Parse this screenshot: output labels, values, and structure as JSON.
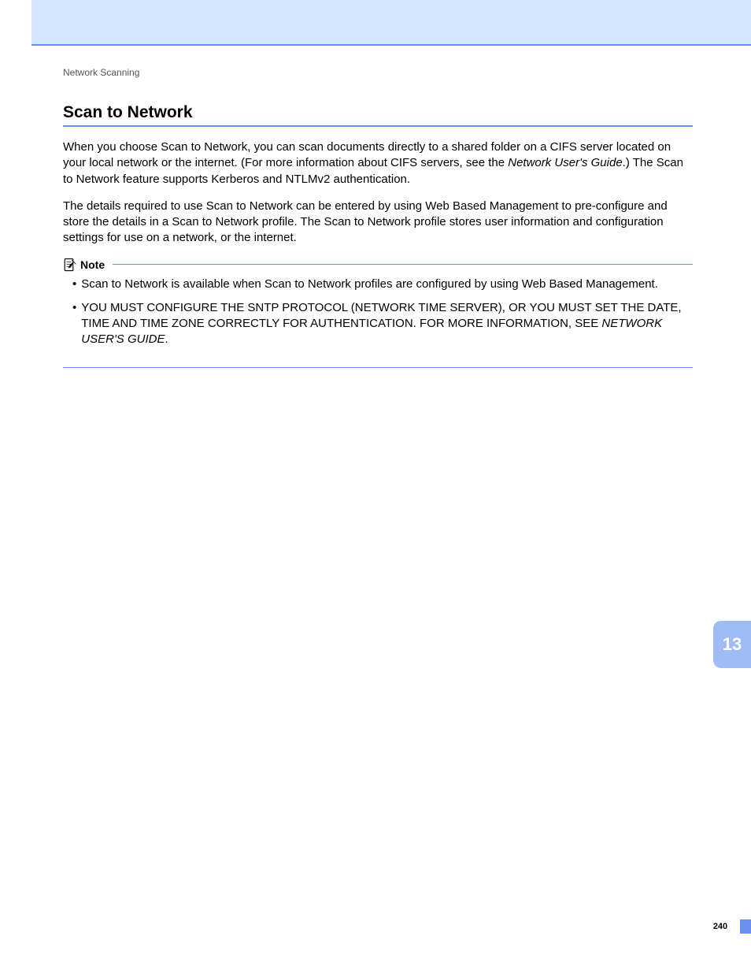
{
  "header": {
    "chapter": "Network Scanning",
    "section_title": "Scan to Network"
  },
  "paragraphs": {
    "p1_a": "When you choose Scan to Network, you can scan documents directly to a shared folder on a CIFS server located on your local network or the internet. (For more information about CIFS servers, see the ",
    "p1_ref": "Network User's Guide",
    "p1_b": ".) The Scan to Network feature supports Kerberos and NTLMv2 authentication.",
    "p2": "The details required to use Scan to Network can be entered by using Web Based Management to pre-configure and store the details in a Scan to Network profile. The Scan to Network profile stores user information and configuration settings for use on a network, or the internet."
  },
  "note": {
    "label": "Note",
    "items": {
      "i1": "Scan to Network is available when Scan to Network profiles are configured by using Web Based Management.",
      "i2_a": "YOU MUST CONFIGURE THE SNTP PROTOCOL (NETWORK TIME SERVER), OR YOU MUST SET THE DATE, TIME AND TIME ZONE CORRECTLY FOR AUTHENTICATION. FOR MORE INFORMATION, SEE ",
      "i2_ref": "NETWORK USER'S GUIDE",
      "i2_b": "."
    }
  },
  "side_tab": "13",
  "page_number": "240"
}
